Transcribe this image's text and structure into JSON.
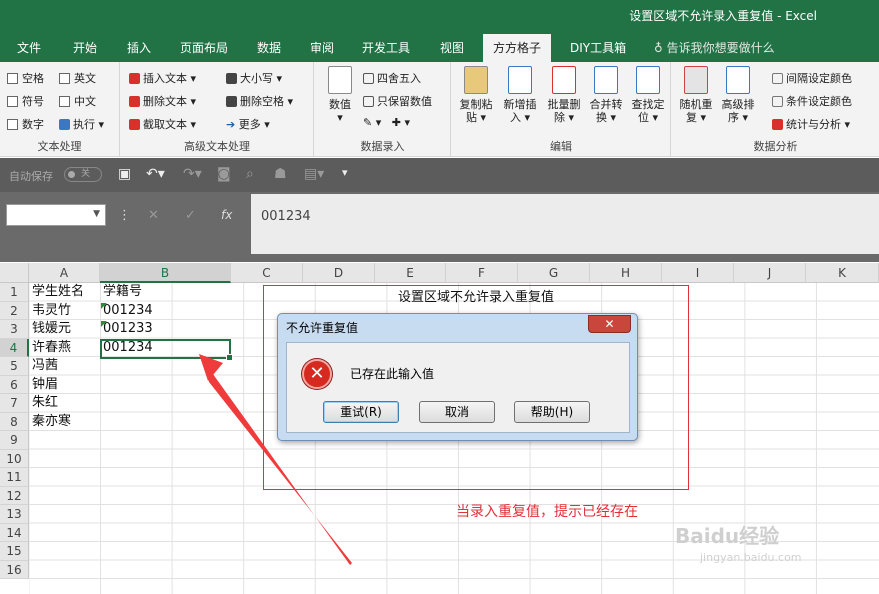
{
  "window": {
    "title": "设置区域不允许录入重复值 - Excel"
  },
  "tabs": [
    "文件",
    "开始",
    "插入",
    "页面布局",
    "数据",
    "审阅",
    "开发工具",
    "视图",
    "方方格子",
    "DIY工具箱"
  ],
  "active_tab": "方方格子",
  "tell_me": "告诉我你想要做什么",
  "ribbon": {
    "text_group": {
      "label": "文本处理",
      "items": [
        "空格",
        "英文",
        "符号",
        "中文",
        "数字",
        "执行"
      ]
    },
    "adv_text_group": {
      "label": "高级文本处理",
      "items": [
        "插入文本",
        "删除文本",
        "截取文本",
        "大小写",
        "删除空格",
        "更多"
      ]
    },
    "data_entry_group": {
      "label": "数据录入",
      "big": "数值",
      "items": [
        "四舍五入",
        "只保留数值"
      ]
    },
    "edit_group": {
      "label": "编辑",
      "buttons": [
        "复制粘\n贴",
        "新增插\n入",
        "批量删\n除",
        "合并转\n换",
        "查找定\n位"
      ]
    },
    "analysis_group": {
      "label": "数据分析",
      "buttons": [
        "随机重\n复",
        "高级排\n序"
      ],
      "items": [
        "间隔设定颜色",
        "条件设定颜色",
        "统计与分析"
      ]
    }
  },
  "qat": {
    "autosave_label": "自动保存",
    "autosave_state": "关"
  },
  "formula_bar": {
    "name_box": "",
    "fx": "fx",
    "value": "001234"
  },
  "columns": [
    "A",
    "B",
    "C",
    "D",
    "E",
    "F",
    "G",
    "H",
    "I",
    "J",
    "K"
  ],
  "selected_column": "B",
  "rows": [
    "1",
    "2",
    "3",
    "4",
    "5",
    "6",
    "7",
    "8",
    "9",
    "10",
    "11",
    "12",
    "13",
    "14",
    "15",
    "16"
  ],
  "selected_row": "4",
  "cells": {
    "A": [
      "学生姓名",
      "韦灵竹",
      "钱媛元",
      "许春燕",
      "冯茜",
      "钟眉",
      "朱红",
      "秦亦寒"
    ],
    "B": [
      "学籍号",
      "001234",
      "001233",
      "001234"
    ]
  },
  "annotation": {
    "box_title": "设置区域不允许录入重复值",
    "note": "当录入重复值，提示已经存在"
  },
  "dialog": {
    "title": "不允许重复值",
    "message": "已存在此输入值",
    "close": "✕",
    "buttons": [
      "重试(R)",
      "取消",
      "帮助(H)"
    ]
  },
  "watermark": {
    "text": "Baidu经验",
    "sub": "jingyan.baidu.com"
  }
}
